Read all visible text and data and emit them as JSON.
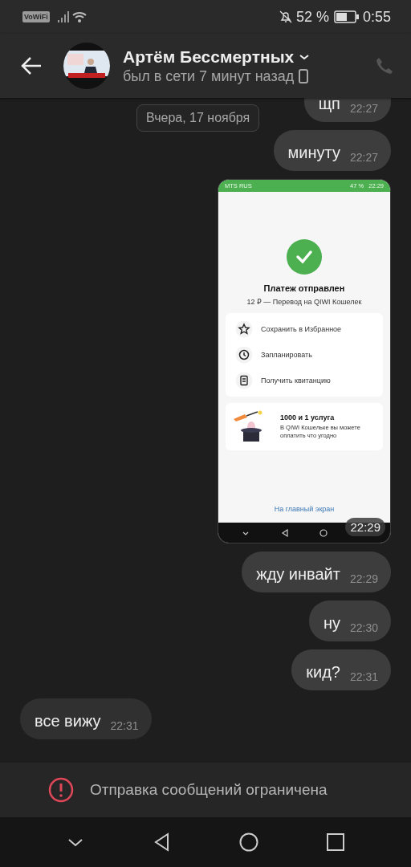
{
  "status_bar": {
    "badge": "VoWiFi",
    "battery": "52 %",
    "time": "0:55"
  },
  "header": {
    "name": "Артём Бессмертных",
    "status": "был в сети 7 минут назад"
  },
  "date_divider": "Вчера, 17 ноября",
  "messages": [
    {
      "kind": "text",
      "outgoing": true,
      "text": "щп",
      "time": "22:27"
    },
    {
      "kind": "text",
      "outgoing": true,
      "text": "минуту",
      "time": "22:27"
    },
    {
      "outgoing": true,
      "time": "22:29",
      "screenshot": {
        "carrier": "MTS RUS",
        "battery": "47 %",
        "time": "22:29",
        "title": "Платеж отправлен",
        "subtitle": "12 ₽ — Перевод на QIWI Кошелек",
        "actions": [
          "Сохранить в Избранное",
          "Запланировать",
          "Получить квитанцию"
        ],
        "promo": {
          "title": "1000 и 1 услуга",
          "text": "В QIWI Кошельке вы можете оплатить что угодно"
        },
        "link": "На главный экран"
      }
    },
    {
      "kind": "text",
      "outgoing": true,
      "text": "жду инвайт",
      "time": "22:29"
    },
    {
      "kind": "text",
      "outgoing": true,
      "text": "ну",
      "time": "22:30"
    },
    {
      "kind": "text",
      "outgoing": true,
      "text": "кид?",
      "time": "22:31"
    },
    {
      "kind": "text",
      "outgoing": false,
      "text": "все вижу",
      "time": "22:31"
    }
  ],
  "notice": "Отправка сообщений ограничена"
}
